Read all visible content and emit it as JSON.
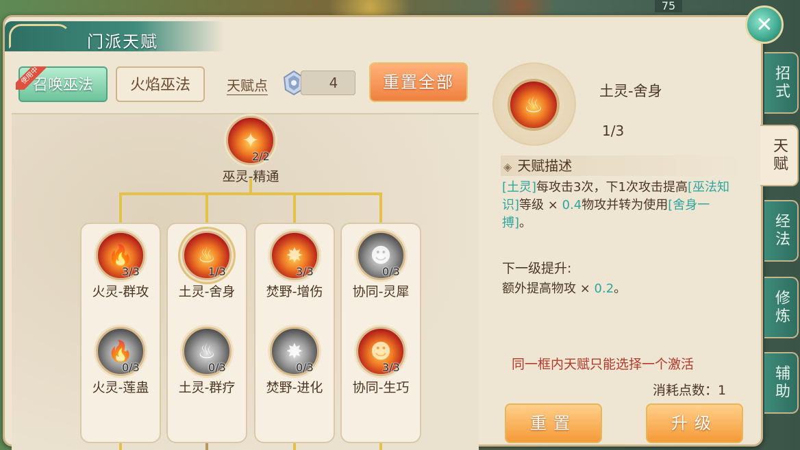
{
  "window": {
    "title": "门派天赋",
    "level_badge": "75"
  },
  "schools": [
    {
      "label": "召唤巫法",
      "active": true,
      "badge": "使用中"
    },
    {
      "label": "火焰巫法",
      "active": false
    }
  ],
  "points": {
    "label": "天赋点",
    "value": "4"
  },
  "reset_all_label": "重置全部",
  "root_node": {
    "name": "巫灵-精通",
    "count": "2/2",
    "state": "active"
  },
  "columns": [
    {
      "top": {
        "name": "火灵-群攻",
        "count": "3/3",
        "state": "active"
      },
      "bottom": {
        "name": "火灵-莲蛊",
        "count": "0/3",
        "state": "inactive"
      }
    },
    {
      "top": {
        "name": "土灵-舍身",
        "count": "1/3",
        "state": "active"
      },
      "bottom": {
        "name": "土灵-群疗",
        "count": "0/3",
        "state": "inactive"
      }
    },
    {
      "top": {
        "name": "焚野-增伤",
        "count": "3/3",
        "state": "active"
      },
      "bottom": {
        "name": "焚野-进化",
        "count": "0/3",
        "state": "inactive"
      }
    },
    {
      "top": {
        "name": "协同-灵犀",
        "count": "0/3",
        "state": "inactive"
      },
      "bottom": {
        "name": "协同-生巧",
        "count": "3/3",
        "state": "active"
      }
    }
  ],
  "detail": {
    "name": "土灵-舍身",
    "level": "1/3",
    "desc_header": "天赋描述",
    "desc_parts": {
      "p1": "[土灵]",
      "p2": "每攻击3次，下1次攻击提高",
      "p3": "[巫法知识]",
      "p4": "等级 × ",
      "p5": "0.4",
      "p6": "物攻并转为使用",
      "p7": "[舍身一搏]",
      "p8": "。"
    },
    "next_title": "下一级提升:",
    "next_parts": {
      "n1": "额外提高物攻 × ",
      "n2": "0.2",
      "n3": "。"
    },
    "warning": "同一框内天赋只能选择一个激活",
    "cost": "消耗点数：1",
    "reset_label": "重置",
    "upgrade_label": "升级"
  },
  "side_tabs": [
    {
      "label": "招式",
      "active": false
    },
    {
      "label": "天赋",
      "active": true
    },
    {
      "label": "经法",
      "active": false
    },
    {
      "label": "修炼",
      "active": false
    },
    {
      "label": "辅助",
      "active": false
    }
  ],
  "colors": {
    "accent_teal": "#2ea6a0",
    "warning_red": "#b23a2a",
    "connector_gold": "#e4c24a",
    "button_orange": "#f59a38"
  },
  "icons": {
    "close": "close-icon",
    "points": "talent-crystal-icon",
    "desc": "diamond-bullet-icon"
  }
}
